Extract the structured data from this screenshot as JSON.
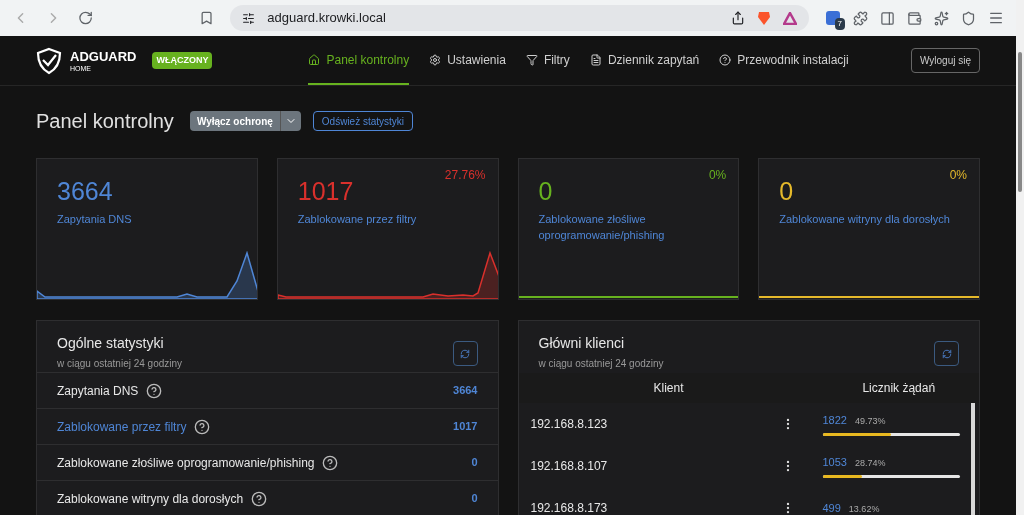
{
  "browser": {
    "url": "adguard.krowki.local",
    "extension_badge": "7"
  },
  "header": {
    "logo_title": "ADGUARD",
    "logo_subtitle": "HOME",
    "status_badge": "WŁĄCZONY",
    "nav": [
      {
        "label": "Panel kontrolny",
        "selected": true,
        "kind": "home"
      },
      {
        "label": "Ustawienia",
        "selected": false,
        "kind": "settings"
      },
      {
        "label": "Filtry",
        "selected": false,
        "kind": "filter"
      },
      {
        "label": "Dziennik zapytań",
        "selected": false,
        "kind": "log"
      },
      {
        "label": "Przewodnik instalacji",
        "selected": false,
        "kind": "help"
      }
    ],
    "logout": "Wyloguj się"
  },
  "page": {
    "title": "Panel kontrolny",
    "protection_button": "Wyłącz ochronę",
    "refresh_button": "Odśwież statystyki"
  },
  "stat_cards": [
    {
      "value": "3664",
      "label": "Zapytania DNS",
      "color": "#4f86d6"
    },
    {
      "value": "1017",
      "label": "Zablokowane przez filtry",
      "percent": "27.76%",
      "color": "#d9302c"
    },
    {
      "value": "0",
      "label": "Zablokowane złośliwe oprogramowanie/phishing",
      "percent": "0%",
      "color": "#67b21f"
    },
    {
      "value": "0",
      "label": "Zablokowane witryny dla dorosłych",
      "percent": "0%",
      "color": "#e5b92b"
    }
  ],
  "general_stats": {
    "title": "Ogólne statystyki",
    "subtitle": "w ciągu ostatniej 24 godziny",
    "rows": [
      {
        "label": "Zapytania DNS",
        "value": "3664",
        "kind": "plain"
      },
      {
        "label": "Zablokowane przez filtry",
        "value": "1017",
        "kind": "link"
      },
      {
        "label": "Zablokowane złośliwe oprogramowanie/phishing",
        "value": "0",
        "kind": "plain"
      },
      {
        "label": "Zablokowane witryny dla dorosłych",
        "value": "0",
        "kind": "plain"
      }
    ]
  },
  "top_clients": {
    "title": "Główni klienci",
    "subtitle": "w ciągu ostatniej 24 godziny",
    "columns": [
      "Klient",
      "Licznik żądań"
    ],
    "rows": [
      {
        "client": "192.168.8.123",
        "count": "1822",
        "percent": "49.73%",
        "level": 0.4973
      },
      {
        "client": "192.168.8.107",
        "count": "1053",
        "percent": "28.74%",
        "level": 0.2874
      },
      {
        "client": "192.168.8.173",
        "count": "499",
        "percent": "13.62%"
      }
    ]
  }
}
